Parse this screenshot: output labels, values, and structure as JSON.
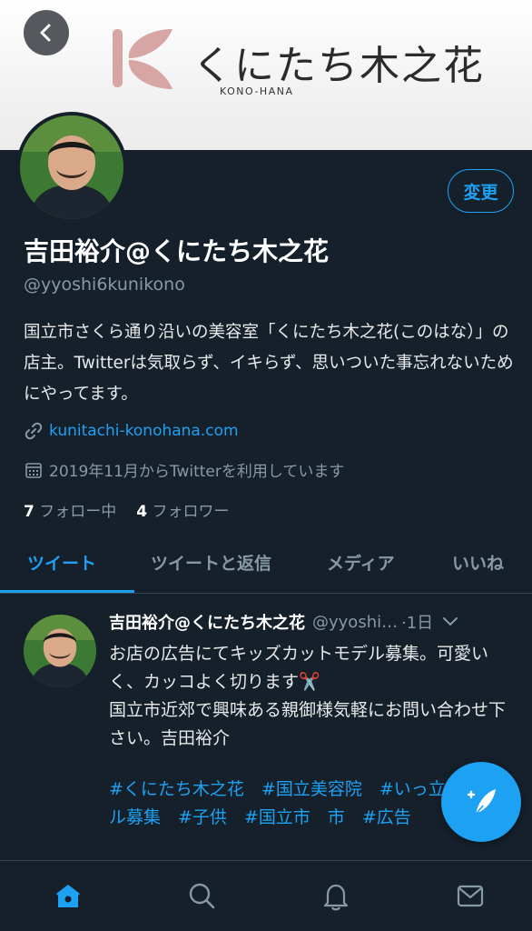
{
  "banner": {
    "logo_text": "くにたち木之花",
    "logo_sub": "KONO-HANA",
    "logo_color": "#d8a5a5"
  },
  "profile": {
    "edit_label": "変更",
    "name": "吉田裕介@くにたち木之花",
    "handle": "@yyoshi6kunikono",
    "bio": "国立市さくら通り沿いの美容室「くにたち木之花(このはな）」の店主。Twitterは気取らず、イキらず、思いついた事忘れないためにやってます。",
    "link": "kunitachi-konohana.com",
    "joined": "2019年11月からTwitterを利用しています",
    "following_count": "7",
    "following_label": "フォロー中",
    "followers_count": "4",
    "followers_label": "フォロワー"
  },
  "tabs": [
    {
      "label": "ツイート",
      "active": true
    },
    {
      "label": "ツイートと返信",
      "active": false
    },
    {
      "label": "メディア",
      "active": false
    },
    {
      "label": "いいね",
      "active": false
    }
  ],
  "tweet": {
    "name": "吉田裕介@くにたち木之花",
    "handle": "@yyoshi6kunikono",
    "time": "·1日",
    "line1": "お店の広告にてキッズカットモデル募集。可愛いく、カッコよく切ります✂️",
    "line2": "国立市近郊で興味ある親御様気軽にお問い合わせ下さい。吉田裕介",
    "tags": "#くにたち木之花　#国立美容院　#いっ立　#モデル募集　#子供　#国立市　市　#広告"
  },
  "nav": [
    "home-icon",
    "search-icon",
    "bell-icon",
    "mail-icon"
  ],
  "colors": {
    "accent": "#1da1f2",
    "bg": "#15202b",
    "muted": "#8899a6"
  }
}
